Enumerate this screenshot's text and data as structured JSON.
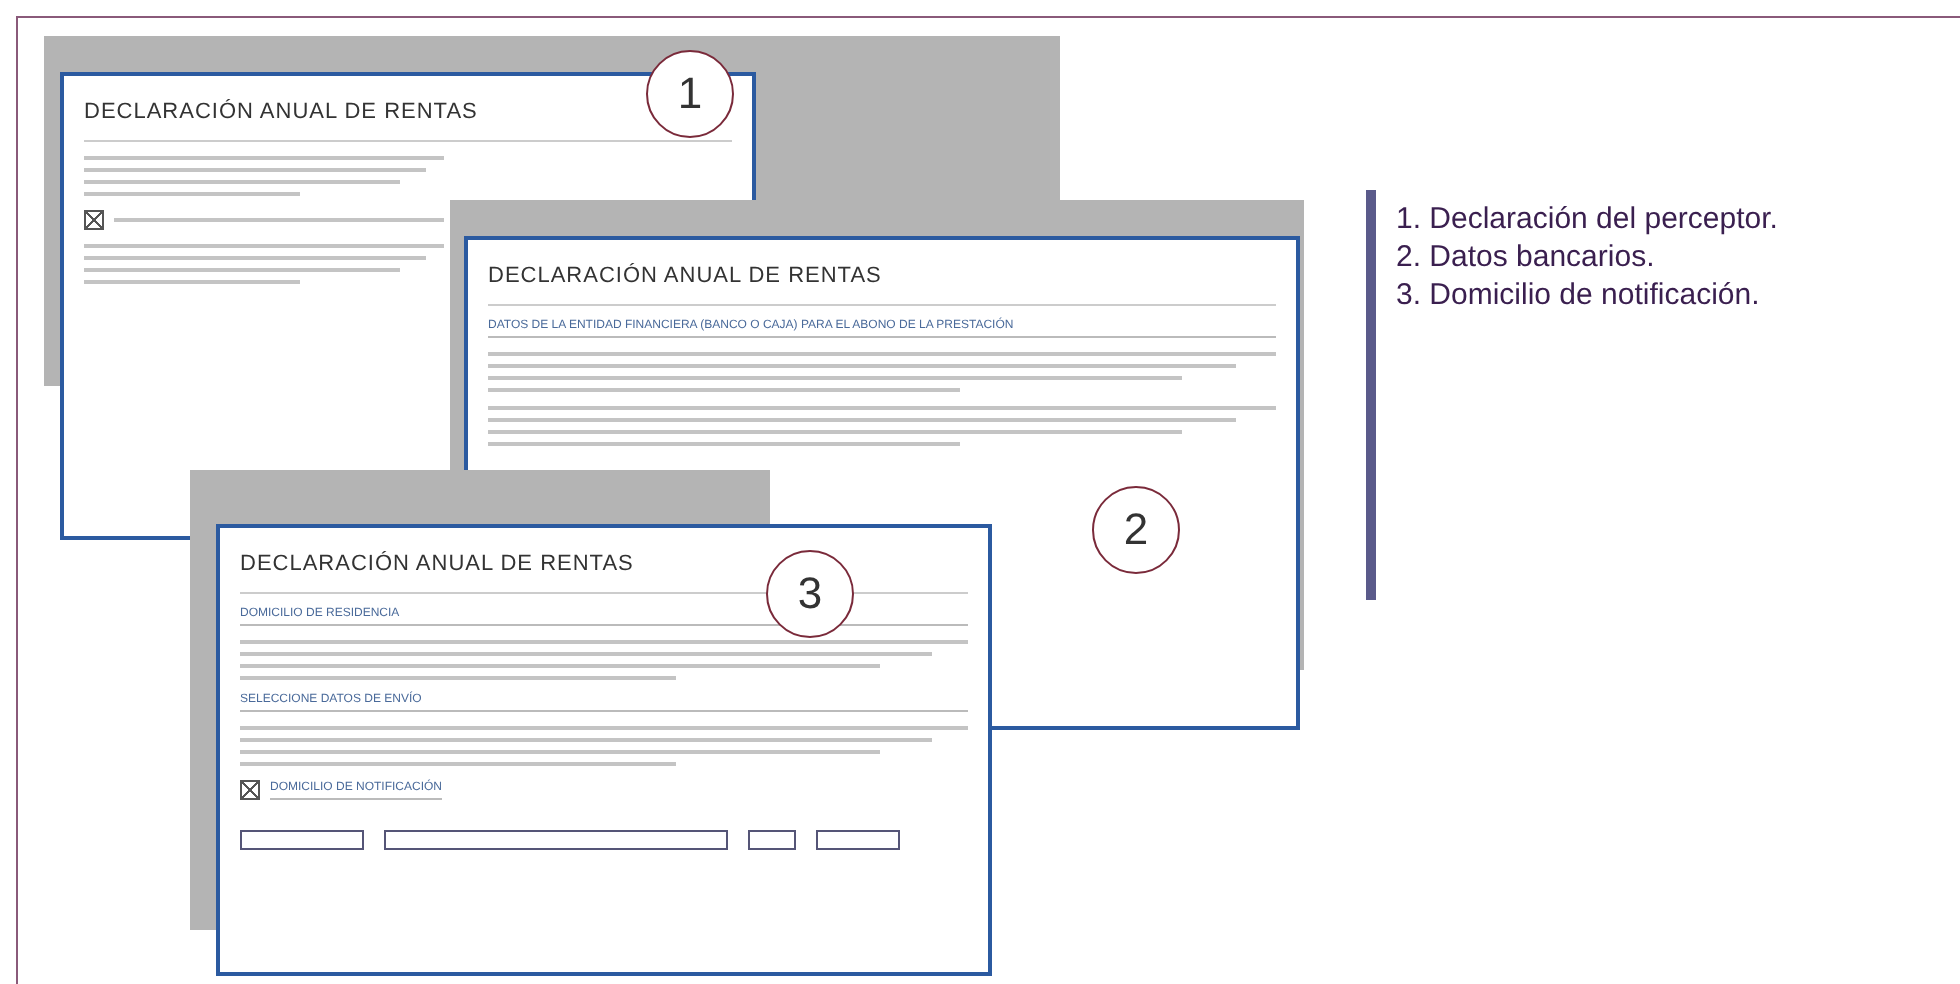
{
  "screens": [
    {
      "title": "DECLARACIÓN ANUAL DE RENTAS",
      "badge": "1",
      "blocks": [
        {
          "kind": "lines"
        },
        {
          "kind": "check",
          "checked": true
        },
        {
          "kind": "lines"
        }
      ]
    },
    {
      "title": "DECLARACIÓN ANUAL DE RENTAS",
      "badge": "2",
      "blocks": [
        {
          "kind": "heading",
          "text": "DATOS DE LA ENTIDAD FINANCIERA (BANCO O CAJA) PARA EL ABONO DE LA PRESTACIÓN"
        },
        {
          "kind": "lines"
        },
        {
          "kind": "lines"
        }
      ]
    },
    {
      "title": "DECLARACIÓN ANUAL DE RENTAS",
      "badge": "3",
      "blocks": [
        {
          "kind": "heading",
          "text": "DOMICILIO DE RESIDENCIA"
        },
        {
          "kind": "lines"
        },
        {
          "kind": "heading",
          "text": "SELECCIONE DATOS DE ENVÍO"
        },
        {
          "kind": "lines"
        },
        {
          "kind": "check",
          "checked": true,
          "text": "DOMICILIO DE NOTIFICACIÓN"
        },
        {
          "kind": "form"
        }
      ]
    }
  ],
  "legend": [
    "1. Declaración del perceptor.",
    "2. Datos bancarios.",
    "3. Domicilio de notificación."
  ]
}
